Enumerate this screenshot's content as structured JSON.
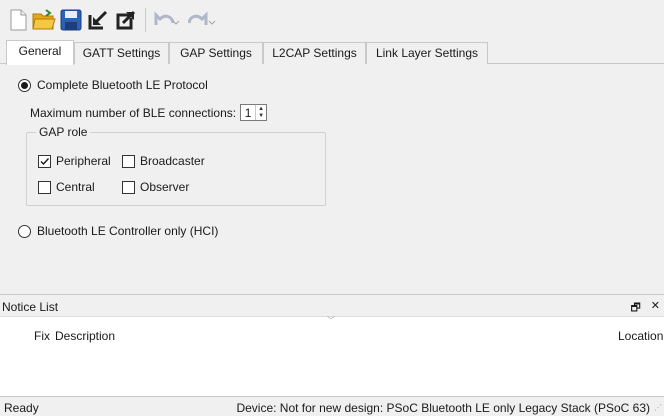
{
  "toolbar": {
    "buttons": [
      {
        "icon": "new-file-icon"
      },
      {
        "icon": "open-folder-icon"
      },
      {
        "icon": "save-icon"
      },
      {
        "icon": "import-icon"
      },
      {
        "icon": "export-icon"
      },
      {
        "icon": "undo-icon"
      },
      {
        "icon": "redo-icon"
      }
    ]
  },
  "tabs": [
    {
      "label": "General"
    },
    {
      "label": "GATT Settings"
    },
    {
      "label": "GAP Settings"
    },
    {
      "label": "L2CAP Settings"
    },
    {
      "label": "Link Layer Settings"
    }
  ],
  "general": {
    "complete_protocol_label": "Complete Bluetooth LE Protocol",
    "complete_protocol_selected": true,
    "max_connections_label": "Maximum number of BLE connections:",
    "max_connections_value": "1",
    "gap_role_title": "GAP role",
    "roles": {
      "peripheral": {
        "label": "Peripheral",
        "checked": true
      },
      "broadcaster": {
        "label": "Broadcaster",
        "checked": false
      },
      "central": {
        "label": "Central",
        "checked": false
      },
      "observer": {
        "label": "Observer",
        "checked": false
      }
    },
    "controller_only_label": "Bluetooth LE Controller only (HCI)",
    "controller_only_selected": false
  },
  "notice_list": {
    "title": "Notice List",
    "columns": {
      "fix": "Fix",
      "description": "Description",
      "location": "Location"
    }
  },
  "status": {
    "left": "Ready",
    "right": "Device: Not for new design: PSoC Bluetooth LE only Legacy Stack (PSoC 63)"
  }
}
